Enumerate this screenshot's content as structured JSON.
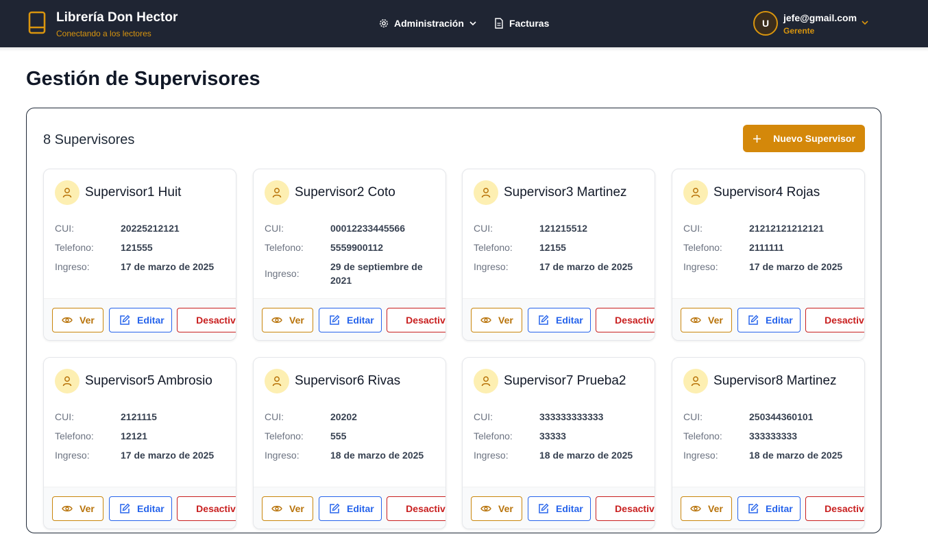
{
  "header": {
    "brand_title": "Librería Don Hector",
    "brand_subtitle": "Conectando a los lectores",
    "nav": {
      "admin_label": "Administración",
      "invoices_label": "Facturas"
    },
    "user": {
      "initial": "U",
      "email": "jefe@gmail.com",
      "role": "Gerente"
    }
  },
  "page": {
    "title": "Gestión de Supervisores"
  },
  "panel": {
    "count_label": "8 Supervisores",
    "new_button_label": "Nuevo Supervisor"
  },
  "labels": {
    "cui": "CUI:",
    "phone": "Telefono:",
    "joined": "Ingreso:",
    "view": "Ver",
    "edit": "Editar",
    "deactivate": "Desactivar"
  },
  "supervisors": [
    {
      "name": "Supervisor1 Huit",
      "cui": "20225212121",
      "phone": "121555",
      "joined": "17 de marzo de 2025"
    },
    {
      "name": "Supervisor2 Coto",
      "cui": "00012233445566",
      "phone": "5559900112",
      "joined": "29 de septiembre de 2021"
    },
    {
      "name": "Supervisor3 Martinez",
      "cui": "121215512",
      "phone": "12155",
      "joined": "17 de marzo de 2025"
    },
    {
      "name": "Supervisor4 Rojas",
      "cui": "21212121212121",
      "phone": "2111111",
      "joined": "17 de marzo de 2025"
    },
    {
      "name": "Supervisor5 Ambrosio",
      "cui": "2121115",
      "phone": "12121",
      "joined": "17 de marzo de 2025"
    },
    {
      "name": "Supervisor6 Rivas",
      "cui": "20202",
      "phone": "555",
      "joined": "18 de marzo de 2025"
    },
    {
      "name": "Supervisor7 Prueba2",
      "cui": "333333333333",
      "phone": "33333",
      "joined": "18 de marzo de 2025"
    },
    {
      "name": "Supervisor8 Martinez",
      "cui": "250344360101",
      "phone": "333333333",
      "joined": "18 de marzo de 2025"
    }
  ],
  "colors": {
    "header_bg": "#1f2533",
    "accent": "#d4880a",
    "edit": "#2563eb",
    "danger": "#c81e1e"
  }
}
